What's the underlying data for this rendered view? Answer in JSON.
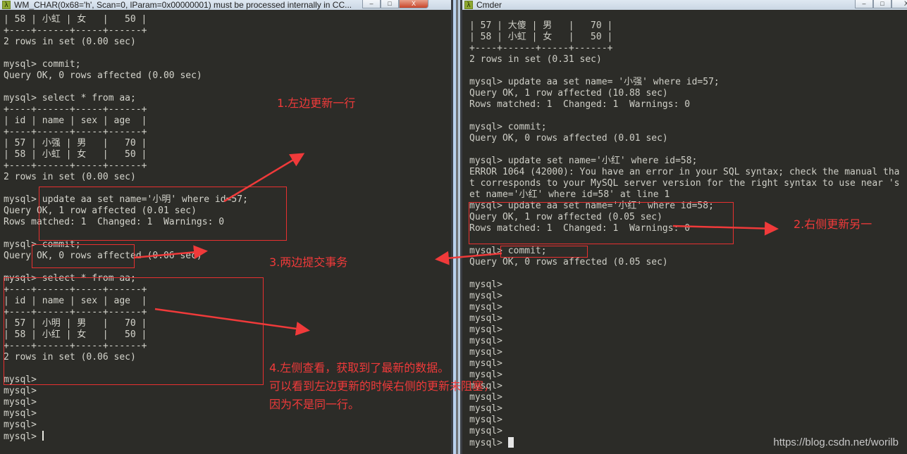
{
  "left_window": {
    "title": "WM_CHAR(0x68='h', Scan=0, lParam=0x00000001) must be processed internally in CC...",
    "icon": "cmder-lambda-icon",
    "buttons": {
      "minimize": "–",
      "maximize": "□",
      "close": "X"
    },
    "lines": [
      "| 58 | 小虹 | 女   |   50 |",
      "+----+------+-----+------+",
      "2 rows in set (0.00 sec)",
      "",
      "mysql> commit;",
      "Query OK, 0 rows affected (0.00 sec)",
      "",
      "mysql> select * from aa;",
      "+----+------+-----+------+",
      "| id | name | sex | age  |",
      "+----+------+-----+------+",
      "| 57 | 小强 | 男   |   70 |",
      "| 58 | 小虹 | 女   |   50 |",
      "+----+------+-----+------+",
      "2 rows in set (0.00 sec)",
      "",
      "mysql> update aa set name='小明' where id=57;",
      "Query OK, 1 row affected (0.01 sec)",
      "Rows matched: 1  Changed: 1  Warnings: 0",
      "",
      "mysql> commit;",
      "Query OK, 0 rows affected (0.06 sec)",
      "",
      "mysql> select * from aa;",
      "+----+------+-----+------+",
      "| id | name | sex | age  |",
      "+----+------+-----+------+",
      "| 57 | 小明 | 男   |   70 |",
      "| 58 | 小红 | 女   |   50 |",
      "+----+------+-----+------+",
      "2 rows in set (0.06 sec)",
      "",
      "mysql>",
      "mysql>",
      "mysql>",
      "mysql>",
      "mysql>",
      "mysql> "
    ]
  },
  "right_window": {
    "title": "Cmder",
    "icon": "cmder-lambda-icon",
    "buttons": {
      "minimize": "–",
      "maximize": "□",
      "close": "X"
    },
    "lines": [
      "| 57 | 大傻 | 男   |   70 |",
      "| 58 | 小虹 | 女   |   50 |",
      "+----+------+-----+------+",
      "2 rows in set (0.31 sec)",
      "",
      "mysql> update aa set name= '小强' where id=57;",
      "Query OK, 1 row affected (10.88 sec)",
      "Rows matched: 1  Changed: 1  Warnings: 0",
      "",
      "mysql> commit;",
      "Query OK, 0 rows affected (0.01 sec)",
      "",
      "mysql> update set name='小红' where id=58;",
      "ERROR 1064 (42000): You have an error in your SQL syntax; check the manual tha",
      "t corresponds to your MySQL server version for the right syntax to use near 's",
      "et name='小红' where id=58' at line 1",
      "mysql> update aa set name='小红' where id=58;",
      "Query OK, 1 row affected (0.05 sec)",
      "Rows matched: 1  Changed: 1  Warnings: 0",
      "",
      "mysql> commit;",
      "Query OK, 0 rows affected (0.05 sec)",
      "",
      "mysql>",
      "mysql>",
      "mysql>",
      "mysql>",
      "mysql>",
      "mysql>",
      "mysql>",
      "mysql>",
      "mysql>",
      "mysql>",
      "mysql>",
      "mysql>",
      "mysql>",
      "mysql>",
      "mysql> "
    ]
  },
  "annotations": {
    "step1": "1.左边更新一行",
    "step2": "2.右侧更新另一",
    "step3": "3.两边提交事务",
    "step4_line1": "4.左侧查看，获取到了最新的数据。",
    "step4_line2": "可以看到左边更新的时候右侧的更新未阻塞，",
    "step4_line3": "因为不是同一行。",
    "color": "#f03a3a"
  },
  "watermark": "https://blog.csdn.net/worilb"
}
